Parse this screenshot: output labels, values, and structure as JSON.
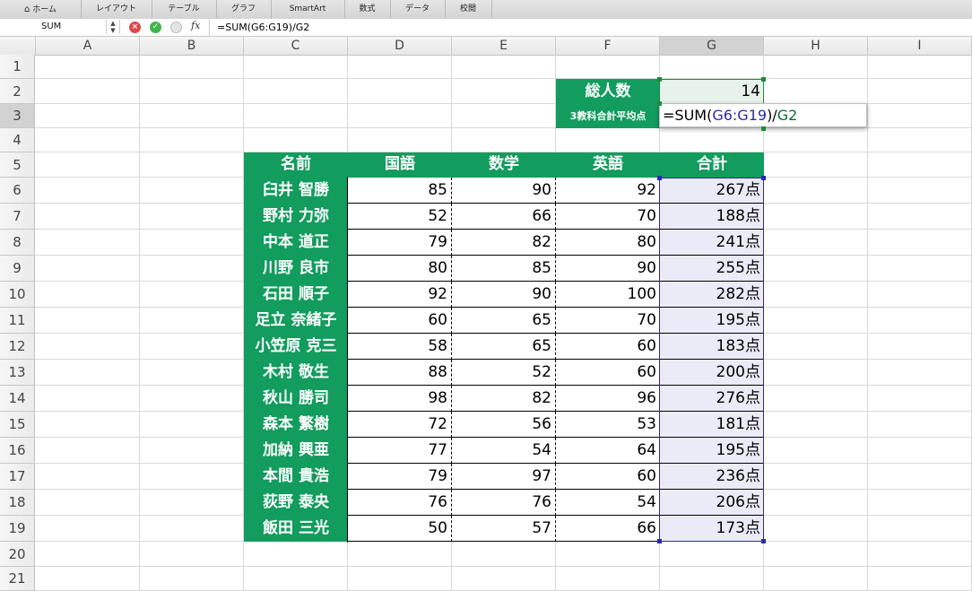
{
  "ribbon": {
    "tabs": [
      "ホーム",
      "レイアウト",
      "テーブル",
      "グラフ",
      "SmartArt",
      "数式",
      "データ",
      "校閲"
    ]
  },
  "formula_bar": {
    "name_box": "SUM",
    "fx_label": "fx",
    "formula": "=SUM(G6:G19)/G2",
    "cancel_color": "#e0474c",
    "enter_color": "#3fb54a"
  },
  "columns": [
    "A",
    "B",
    "C",
    "D",
    "E",
    "F",
    "G",
    "H",
    "I"
  ],
  "rows": [
    "1",
    "2",
    "3",
    "4",
    "5",
    "6",
    "7",
    "8",
    "9",
    "10",
    "11",
    "12",
    "13",
    "14",
    "15",
    "16",
    "17",
    "18",
    "19",
    "20",
    "21"
  ],
  "selected": {
    "column": "G",
    "row": "3"
  },
  "summary": {
    "total_label": "総人数",
    "total_value": "14",
    "avg_label": "3教科合計平均点",
    "edit_formula": {
      "prefix": "=SUM(",
      "range": "G6:G19",
      "mid": ")/",
      "ref": "G2"
    }
  },
  "table": {
    "headers": [
      "名前",
      "国語",
      "数学",
      "英語",
      "合計"
    ],
    "rows": [
      {
        "name": "臼井 智勝",
        "jp": "85",
        "math": "90",
        "en": "92",
        "total": "267点"
      },
      {
        "name": "野村 力弥",
        "jp": "52",
        "math": "66",
        "en": "70",
        "total": "188点"
      },
      {
        "name": "中本 道正",
        "jp": "79",
        "math": "82",
        "en": "80",
        "total": "241点"
      },
      {
        "name": "川野 良市",
        "jp": "80",
        "math": "85",
        "en": "90",
        "total": "255点"
      },
      {
        "name": "石田 順子",
        "jp": "92",
        "math": "90",
        "en": "100",
        "total": "282点"
      },
      {
        "name": "足立 奈緒子",
        "jp": "60",
        "math": "65",
        "en": "70",
        "total": "195点"
      },
      {
        "name": "小笠原 克三",
        "jp": "58",
        "math": "65",
        "en": "60",
        "total": "183点"
      },
      {
        "name": "木村 敬生",
        "jp": "88",
        "math": "52",
        "en": "60",
        "total": "200点"
      },
      {
        "name": "秋山 勝司",
        "jp": "98",
        "math": "82",
        "en": "96",
        "total": "276点"
      },
      {
        "name": "森本 繁樹",
        "jp": "72",
        "math": "56",
        "en": "53",
        "total": "181点"
      },
      {
        "name": "加納 興亜",
        "jp": "77",
        "math": "54",
        "en": "64",
        "total": "195点"
      },
      {
        "name": "本間 貴浩",
        "jp": "79",
        "math": "97",
        "en": "60",
        "total": "236点"
      },
      {
        "name": "荻野 泰央",
        "jp": "76",
        "math": "76",
        "en": "54",
        "total": "206点"
      },
      {
        "name": "飯田 三光",
        "jp": "50",
        "math": "57",
        "en": "66",
        "total": "173点"
      }
    ]
  },
  "colors": {
    "header_green": "#129c5e",
    "range_blue": "#2a2aa8",
    "ref_green": "#0c6b2f",
    "sum_fill": "#ebebf7"
  }
}
